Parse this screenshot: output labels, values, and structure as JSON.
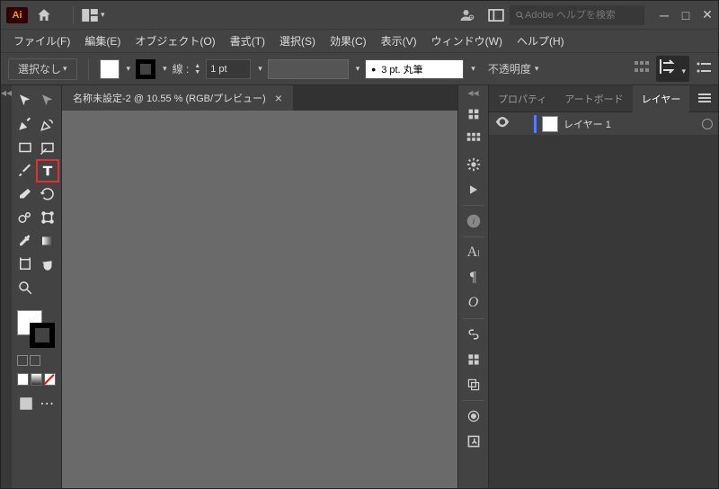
{
  "app": {
    "logo": "Ai"
  },
  "search": {
    "placeholder": "Adobe ヘルプを検索"
  },
  "menu": {
    "file": "ファイル(F)",
    "edit": "編集(E)",
    "object": "オブジェクト(O)",
    "type": "書式(T)",
    "select": "選択(S)",
    "effect": "効果(C)",
    "view": "表示(V)",
    "window": "ウィンドウ(W)",
    "help": "ヘルプ(H)"
  },
  "options": {
    "selection": "選択なし",
    "stroke_label": "線 :",
    "stroke_value": "1 pt",
    "brush": "3 pt. 丸筆",
    "opacity_label": "不透明度",
    "fill_color": "#ffffff",
    "stroke_color": "#000000"
  },
  "document": {
    "tab_title": "名称未設定-2 @ 10.55 % (RGB/プレビュー)"
  },
  "panels": {
    "properties": "プロパティ",
    "artboards": "アートボード",
    "layers": "レイヤー"
  },
  "layers": {
    "items": [
      {
        "name": "レイヤー 1"
      }
    ]
  }
}
